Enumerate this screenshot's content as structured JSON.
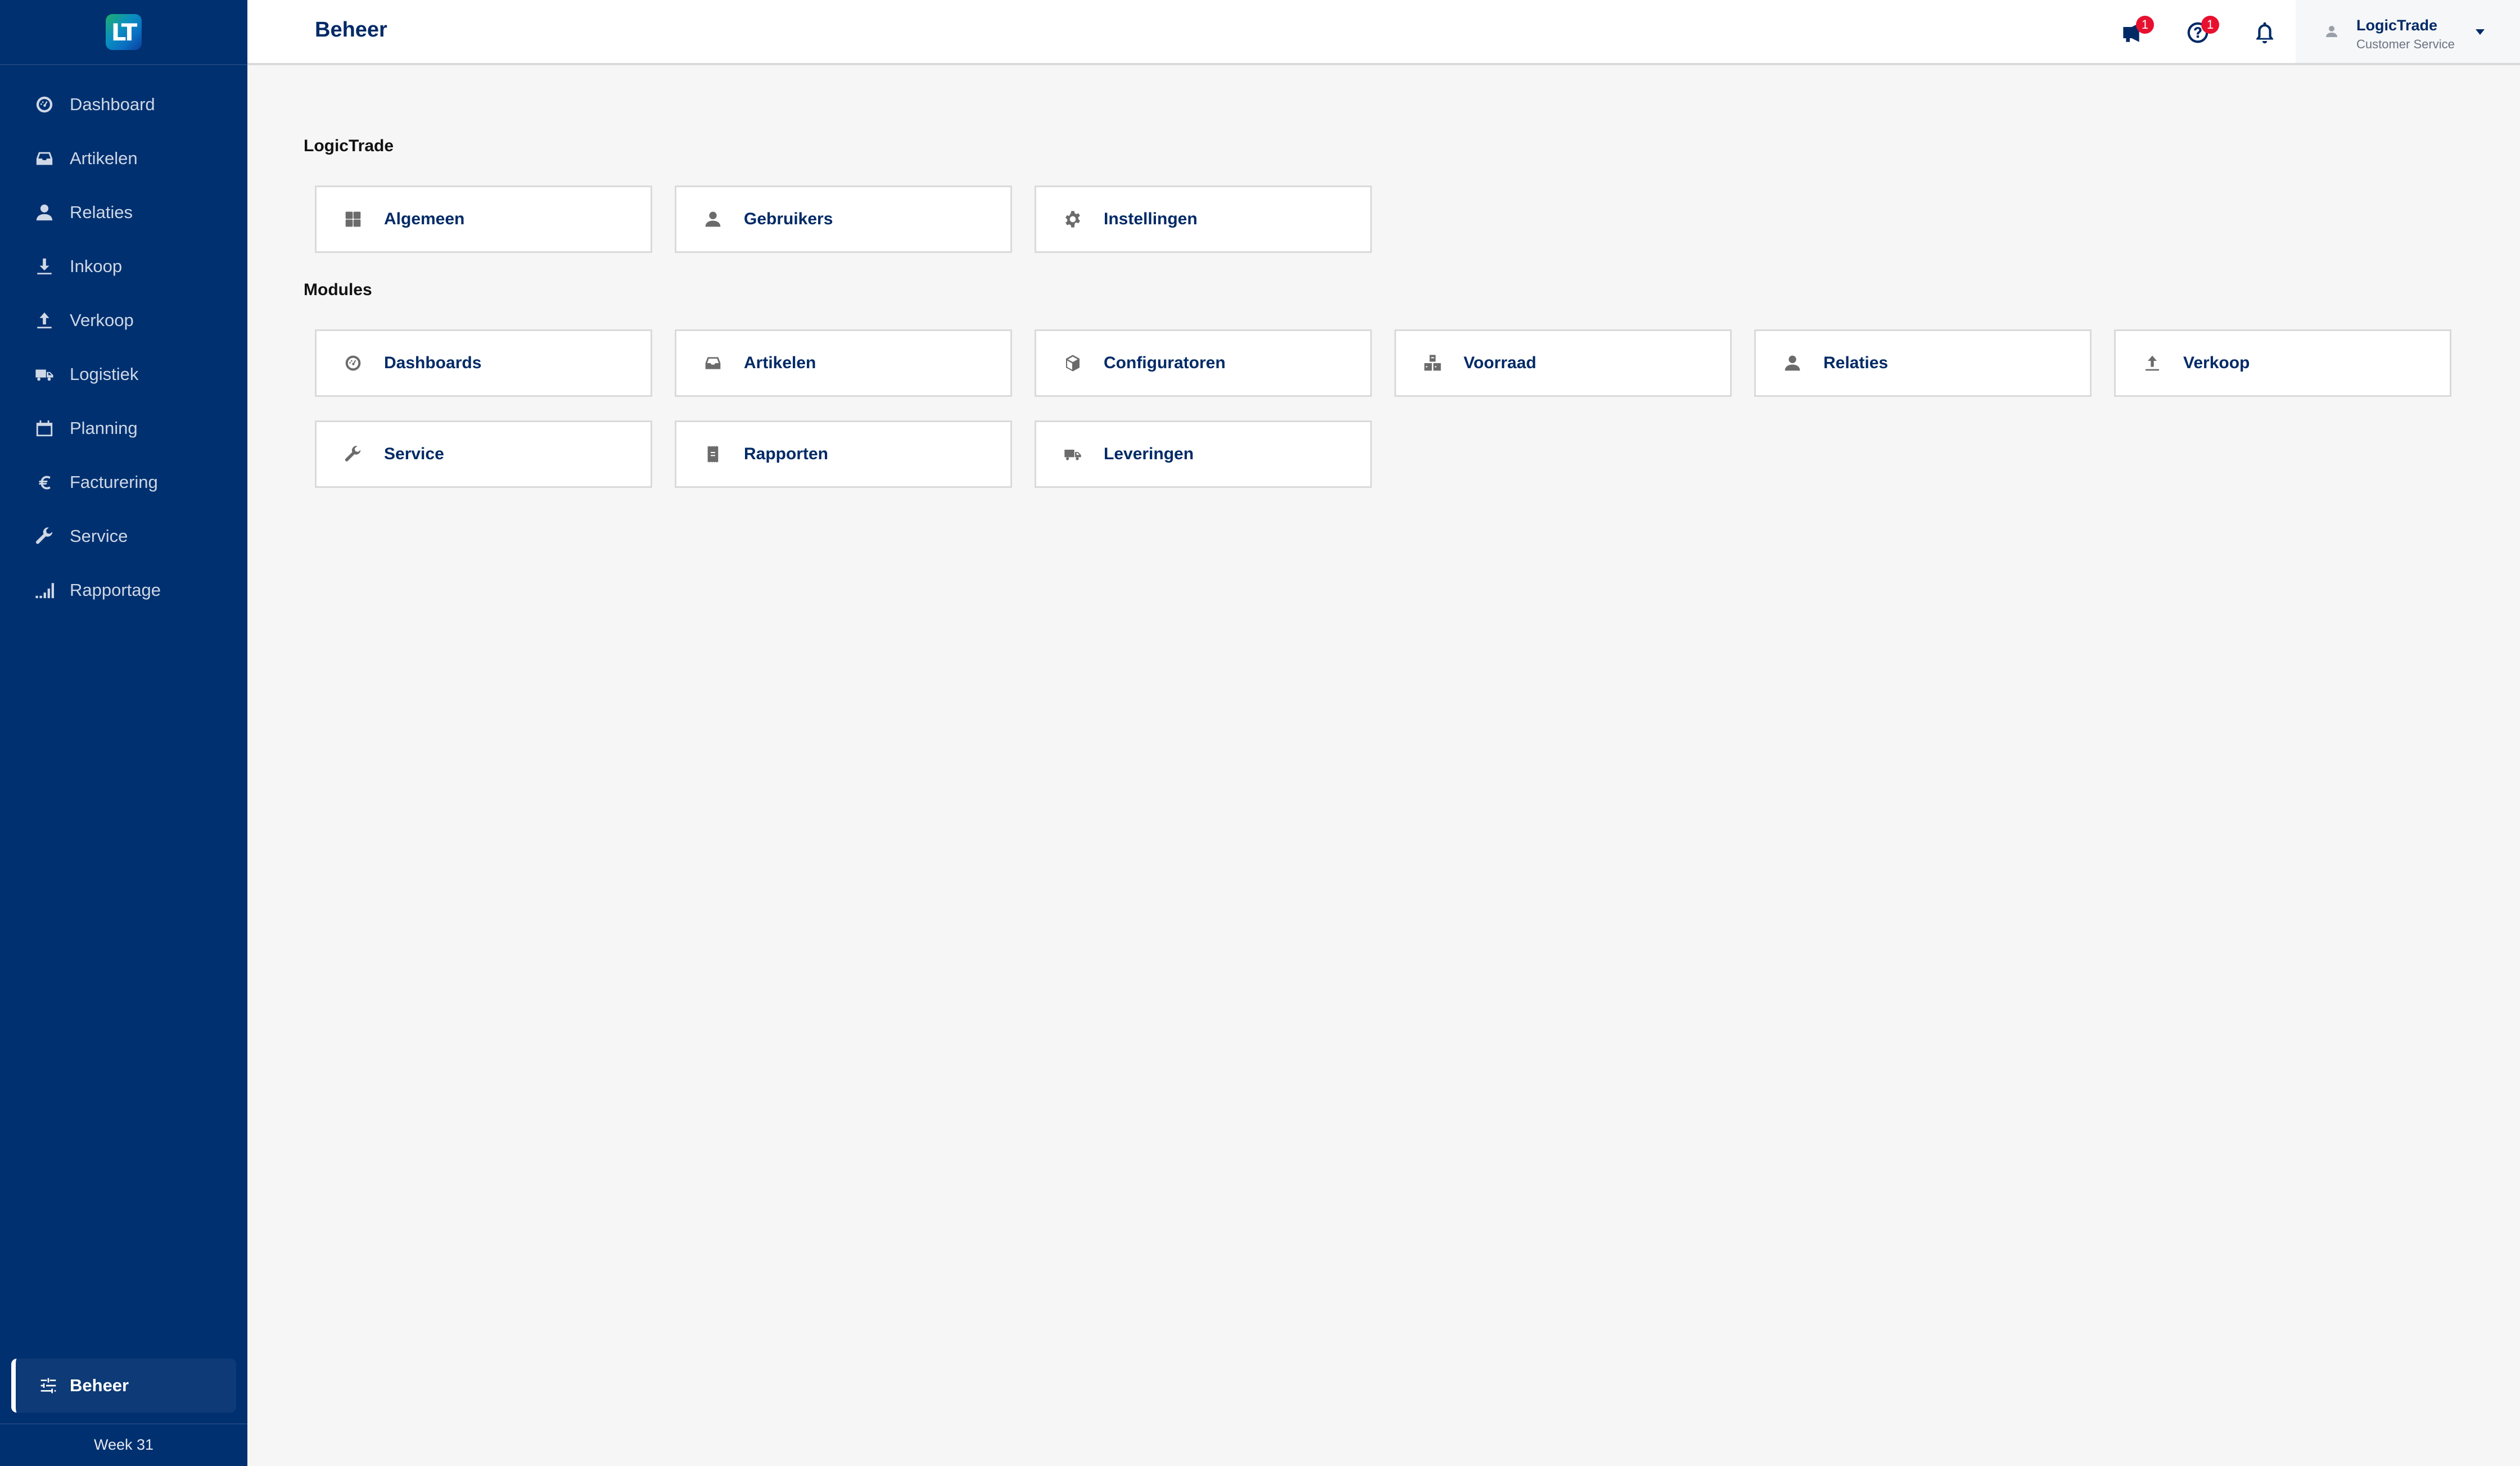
{
  "app": {
    "logo_text": "LT",
    "colors": {
      "sidebar_bg": "#003070",
      "accent": "#002a66",
      "badge": "#e8102f",
      "background": "#f6f6f6",
      "icon_gray": "#6b6b6b"
    }
  },
  "sidebar": {
    "items": [
      {
        "label": "Dashboard",
        "icon": "dashboard-gauge-icon"
      },
      {
        "label": "Artikelen",
        "icon": "inbox-tray-icon"
      },
      {
        "label": "Relaties",
        "icon": "user-icon"
      },
      {
        "label": "Inkoop",
        "icon": "download-icon"
      },
      {
        "label": "Verkoop",
        "icon": "upload-icon"
      },
      {
        "label": "Logistiek",
        "icon": "truck-icon"
      },
      {
        "label": "Planning",
        "icon": "calendar-icon"
      },
      {
        "label": "Facturering",
        "icon": "euro-icon"
      },
      {
        "label": "Service",
        "icon": "wrench-icon"
      },
      {
        "label": "Rapportage",
        "icon": "signal-bars-icon"
      }
    ],
    "active_item": {
      "label": "Beheer",
      "icon": "sliders-icon"
    },
    "week_label": "Week 31"
  },
  "header": {
    "title": "Beheer",
    "announcements": {
      "icon": "megaphone-icon",
      "badge": "1"
    },
    "help": {
      "icon": "help-circle-icon",
      "badge": "1"
    },
    "notifications": {
      "icon": "bell-icon"
    },
    "user": {
      "name": "LogicTrade",
      "role": "Customer Service",
      "icon": "user-avatar-icon",
      "menu_icon": "caret-down-icon"
    }
  },
  "main": {
    "sections": [
      {
        "title": "LogicTrade",
        "cards": [
          {
            "label": "Algemeen",
            "icon": "grid-icon"
          },
          {
            "label": "Gebruikers",
            "icon": "user-icon"
          },
          {
            "label": "Instellingen",
            "icon": "gear-icon"
          }
        ]
      },
      {
        "title": "Modules",
        "cards": [
          {
            "label": "Dashboards",
            "icon": "dashboard-gauge-icon"
          },
          {
            "label": "Artikelen",
            "icon": "inbox-tray-icon"
          },
          {
            "label": "Configuratoren",
            "icon": "cube-icon"
          },
          {
            "label": "Voorraad",
            "icon": "warehouse-boxes-icon"
          },
          {
            "label": "Relaties",
            "icon": "user-icon"
          },
          {
            "label": "Verkoop",
            "icon": "upload-icon"
          },
          {
            "label": "Service",
            "icon": "wrench-icon"
          },
          {
            "label": "Rapporten",
            "icon": "receipt-icon"
          },
          {
            "label": "Leveringen",
            "icon": "truck-icon"
          }
        ]
      }
    ]
  }
}
